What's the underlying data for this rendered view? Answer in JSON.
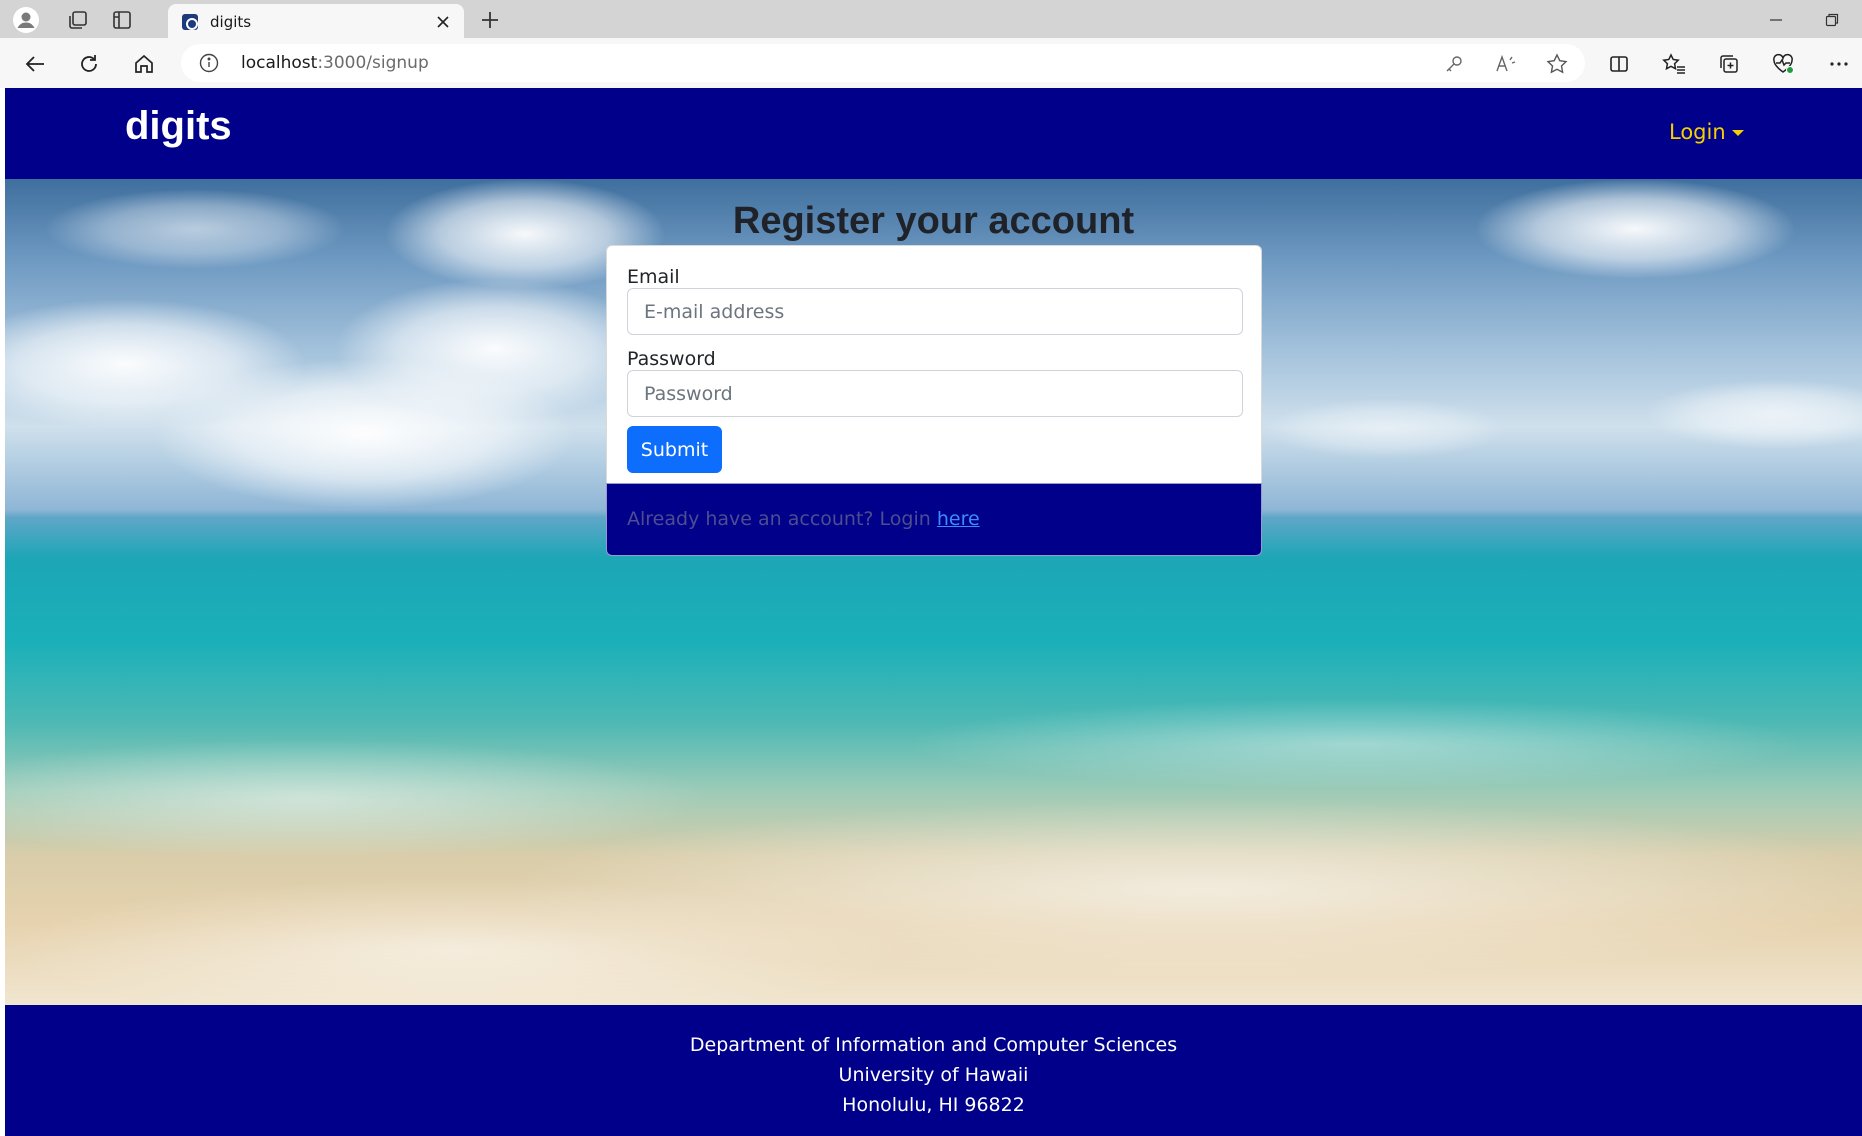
{
  "browser": {
    "tab_title": "digits",
    "url_host": "localhost",
    "url_path": ":3000/signup"
  },
  "nav": {
    "brand": "digits",
    "login_label": "Login"
  },
  "form": {
    "heading": "Register your account",
    "email_label": "Email",
    "email_placeholder": "E-mail address",
    "password_label": "Password",
    "password_placeholder": "Password",
    "submit_label": "Submit"
  },
  "card_footer": {
    "text": "Already have an account? Login ",
    "link_text": "here"
  },
  "footer": {
    "line1": "Department of Information and Computer Sciences",
    "line2": "University of Hawaii",
    "line3": "Honolulu, HI 96822"
  },
  "colors": {
    "navbar_bg": "#00008b",
    "brand_text": "#ffffff",
    "login_text": "#f5d000",
    "submit_bg": "#0d6efd"
  },
  "icons": {
    "profile": "profile-icon",
    "workspaces": "workspaces-icon",
    "tab_actions": "tab-actions-icon",
    "back": "back-arrow-icon",
    "refresh": "refresh-icon",
    "home": "home-icon",
    "site_info": "info-icon",
    "passwords": "key-icon",
    "read_aloud": "read-aloud-icon",
    "favorite": "star-icon",
    "split_screen": "split-screen-icon",
    "favorites_list": "favorites-icon",
    "collections": "collections-icon",
    "browser_essentials": "heart-pulse-icon",
    "more": "more-icon"
  }
}
